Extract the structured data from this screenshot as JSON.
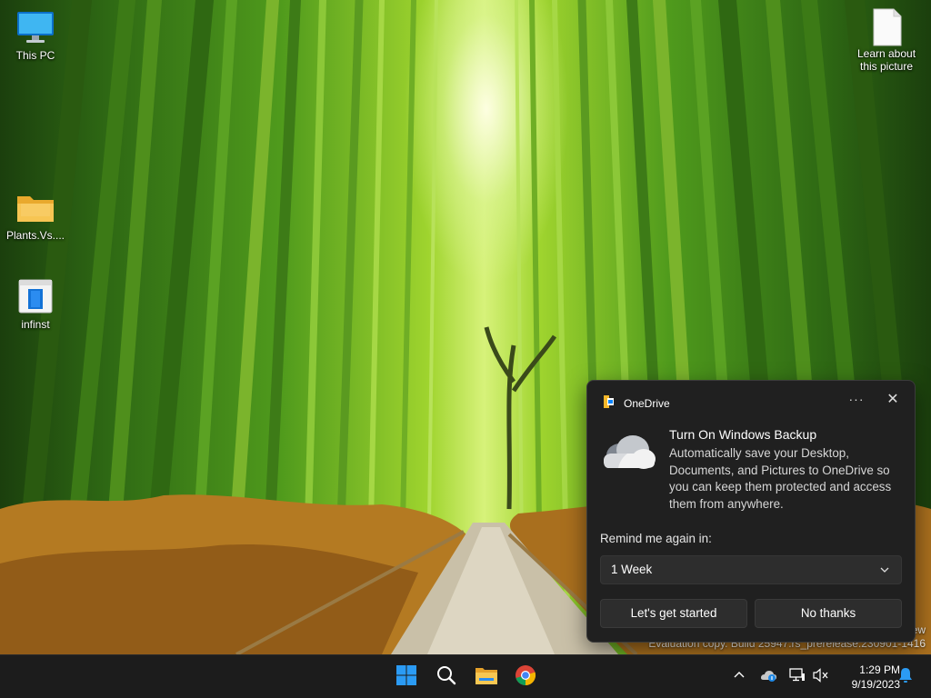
{
  "desktop": {
    "icons": [
      {
        "label": "This PC",
        "icon": "monitor-icon"
      },
      {
        "label": "Plants.Vs....",
        "icon": "folder-icon"
      },
      {
        "label": "infinst",
        "icon": "document-icon"
      },
      {
        "label": "Learn about this picture",
        "icon": "blank-file-icon"
      }
    ],
    "watermark": {
      "line1": "ew",
      "line2": "Evaluation copy. Build 25947.rs_prerelease.230901-1416"
    }
  },
  "toast": {
    "app_name": "OneDrive",
    "more_label": "···",
    "close_label": "✕",
    "title": "Turn On Windows Backup",
    "body": "Automatically save your Desktop, Documents, and Pictures to OneDrive so you can keep them protected and access them from anywhere.",
    "remind_label": "Remind me again in:",
    "remind_value": "1 Week",
    "primary_button": "Let's get started",
    "secondary_button": "No thanks"
  },
  "taskbar": {
    "apps": [
      "windows-start-icon",
      "search-icon",
      "file-explorer-icon",
      "chrome-icon"
    ],
    "tray": [
      "chevron-up-icon",
      "onedrive-icon",
      "network-icon",
      "volume-muted-icon"
    ],
    "time": "1:29 PM",
    "date": "9/19/2023",
    "notification_icon": "bell-icon"
  },
  "colors": {
    "taskbar_bg": "#1c1c1c",
    "toast_bg": "#202020",
    "accent_blue": "#0a84ff"
  }
}
